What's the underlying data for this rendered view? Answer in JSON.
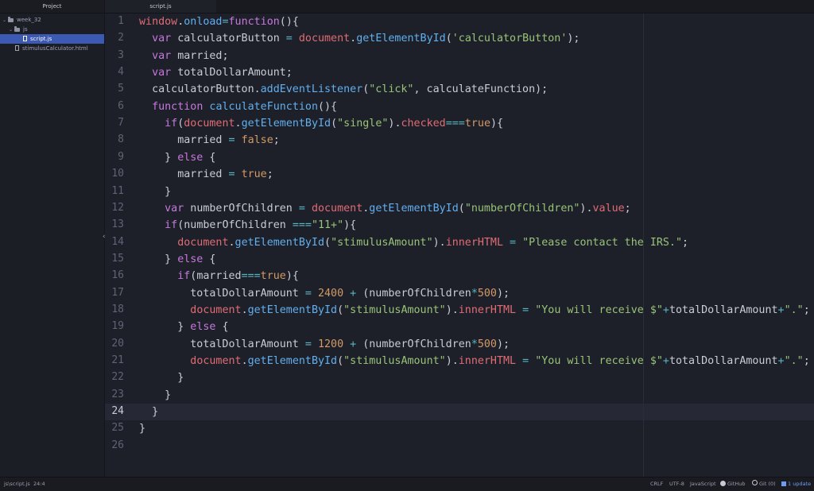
{
  "sidebar": {
    "header": "Project",
    "tree": [
      {
        "label": "week_32",
        "type": "folder",
        "expanded": true,
        "selected": false
      },
      {
        "label": "js",
        "type": "folder",
        "expanded": true,
        "selected": false
      },
      {
        "label": "script.js",
        "type": "file",
        "selected": true
      },
      {
        "label": "stimulusCalculator.html",
        "type": "file",
        "selected": false
      }
    ],
    "toggle_icon": "‹"
  },
  "tabs": [
    {
      "label": "script.js",
      "active": true
    }
  ],
  "editor": {
    "language": "JavaScript",
    "current_line": 24,
    "lines": [
      [
        [
          "vr",
          "window"
        ],
        [
          "pl",
          "."
        ],
        [
          "fn",
          "onload"
        ],
        [
          "op",
          "="
        ],
        [
          "kw",
          "function"
        ],
        [
          "pl",
          "(){"
        ]
      ],
      [
        [
          "pl",
          "  "
        ],
        [
          "kw",
          "var"
        ],
        [
          "pl",
          " calculatorButton "
        ],
        [
          "op",
          "="
        ],
        [
          "pl",
          " "
        ],
        [
          "vr",
          "document"
        ],
        [
          "pl",
          "."
        ],
        [
          "fn",
          "getElementById"
        ],
        [
          "pl",
          "("
        ],
        [
          "st",
          "'calculatorButton'"
        ],
        [
          "pl",
          ");"
        ]
      ],
      [
        [
          "pl",
          "  "
        ],
        [
          "kw",
          "var"
        ],
        [
          "pl",
          " married;"
        ]
      ],
      [
        [
          "pl",
          "  "
        ],
        [
          "kw",
          "var"
        ],
        [
          "pl",
          " totalDollarAmount;"
        ]
      ],
      [
        [
          "pl",
          "  calculatorButton."
        ],
        [
          "fn",
          "addEventListener"
        ],
        [
          "pl",
          "("
        ],
        [
          "st",
          "\"click\""
        ],
        [
          "pl",
          ", calculateFunction);"
        ]
      ],
      [
        [
          "pl",
          "  "
        ],
        [
          "kw",
          "function"
        ],
        [
          "pl",
          " "
        ],
        [
          "fn",
          "calculateFunction"
        ],
        [
          "pl",
          "(){"
        ]
      ],
      [
        [
          "pl",
          "    "
        ],
        [
          "kw",
          "if"
        ],
        [
          "pl",
          "("
        ],
        [
          "vr",
          "document"
        ],
        [
          "pl",
          "."
        ],
        [
          "fn",
          "getElementById"
        ],
        [
          "pl",
          "("
        ],
        [
          "st",
          "\"single\""
        ],
        [
          "pl",
          ")."
        ],
        [
          "vr",
          "checked"
        ],
        [
          "op",
          "==="
        ],
        [
          "nm",
          "true"
        ],
        [
          "pl",
          "){"
        ]
      ],
      [
        [
          "pl",
          "      married "
        ],
        [
          "op",
          "="
        ],
        [
          "pl",
          " "
        ],
        [
          "nm",
          "false"
        ],
        [
          "pl",
          ";"
        ]
      ],
      [
        [
          "pl",
          "    } "
        ],
        [
          "kw",
          "else"
        ],
        [
          "pl",
          " {"
        ]
      ],
      [
        [
          "pl",
          "      married "
        ],
        [
          "op",
          "="
        ],
        [
          "pl",
          " "
        ],
        [
          "nm",
          "true"
        ],
        [
          "pl",
          ";"
        ]
      ],
      [
        [
          "pl",
          "    }"
        ]
      ],
      [
        [
          "pl",
          "    "
        ],
        [
          "kw",
          "var"
        ],
        [
          "pl",
          " numberOfChildren "
        ],
        [
          "op",
          "="
        ],
        [
          "pl",
          " "
        ],
        [
          "vr",
          "document"
        ],
        [
          "pl",
          "."
        ],
        [
          "fn",
          "getElementById"
        ],
        [
          "pl",
          "("
        ],
        [
          "st",
          "\"numberOfChildren\""
        ],
        [
          "pl",
          ")."
        ],
        [
          "vr",
          "value"
        ],
        [
          "pl",
          ";"
        ]
      ],
      [
        [
          "pl",
          "    "
        ],
        [
          "kw",
          "if"
        ],
        [
          "pl",
          "(numberOfChildren "
        ],
        [
          "op",
          "==="
        ],
        [
          "st",
          "\"11+\""
        ],
        [
          "pl",
          "){"
        ]
      ],
      [
        [
          "pl",
          "      "
        ],
        [
          "vr",
          "document"
        ],
        [
          "pl",
          "."
        ],
        [
          "fn",
          "getElementById"
        ],
        [
          "pl",
          "("
        ],
        [
          "st",
          "\"stimulusAmount\""
        ],
        [
          "pl",
          ")."
        ],
        [
          "vr",
          "innerHTML"
        ],
        [
          "pl",
          " "
        ],
        [
          "op",
          "="
        ],
        [
          "pl",
          " "
        ],
        [
          "st",
          "\"Please contact the IRS.\""
        ],
        [
          "pl",
          ";"
        ]
      ],
      [
        [
          "pl",
          "    } "
        ],
        [
          "kw",
          "else"
        ],
        [
          "pl",
          " {"
        ]
      ],
      [
        [
          "pl",
          "      "
        ],
        [
          "kw",
          "if"
        ],
        [
          "pl",
          "(married"
        ],
        [
          "op",
          "==="
        ],
        [
          "nm",
          "true"
        ],
        [
          "pl",
          "){"
        ]
      ],
      [
        [
          "pl",
          "        totalDollarAmount "
        ],
        [
          "op",
          "="
        ],
        [
          "pl",
          " "
        ],
        [
          "nm",
          "2400"
        ],
        [
          "pl",
          " "
        ],
        [
          "op",
          "+"
        ],
        [
          "pl",
          " (numberOfChildren"
        ],
        [
          "op",
          "*"
        ],
        [
          "nm",
          "500"
        ],
        [
          "pl",
          ");"
        ]
      ],
      [
        [
          "pl",
          "        "
        ],
        [
          "vr",
          "document"
        ],
        [
          "pl",
          "."
        ],
        [
          "fn",
          "getElementById"
        ],
        [
          "pl",
          "("
        ],
        [
          "st",
          "\"stimulusAmount\""
        ],
        [
          "pl",
          ")."
        ],
        [
          "vr",
          "innerHTML"
        ],
        [
          "pl",
          " "
        ],
        [
          "op",
          "="
        ],
        [
          "pl",
          " "
        ],
        [
          "st",
          "\"You will receive $\""
        ],
        [
          "op",
          "+"
        ],
        [
          "pl",
          "totalDollarAmount"
        ],
        [
          "op",
          "+"
        ],
        [
          "st",
          "\".\""
        ],
        [
          "pl",
          ";"
        ]
      ],
      [
        [
          "pl",
          "      } "
        ],
        [
          "kw",
          "else"
        ],
        [
          "pl",
          " {"
        ]
      ],
      [
        [
          "pl",
          "        totalDollarAmount "
        ],
        [
          "op",
          "="
        ],
        [
          "pl",
          " "
        ],
        [
          "nm",
          "1200"
        ],
        [
          "pl",
          " "
        ],
        [
          "op",
          "+"
        ],
        [
          "pl",
          " (numberOfChildren"
        ],
        [
          "op",
          "*"
        ],
        [
          "nm",
          "500"
        ],
        [
          "pl",
          ");"
        ]
      ],
      [
        [
          "pl",
          "        "
        ],
        [
          "vr",
          "document"
        ],
        [
          "pl",
          "."
        ],
        [
          "fn",
          "getElementById"
        ],
        [
          "pl",
          "("
        ],
        [
          "st",
          "\"stimulusAmount\""
        ],
        [
          "pl",
          ")."
        ],
        [
          "vr",
          "innerHTML"
        ],
        [
          "pl",
          " "
        ],
        [
          "op",
          "="
        ],
        [
          "pl",
          " "
        ],
        [
          "st",
          "\"You will receive $\""
        ],
        [
          "op",
          "+"
        ],
        [
          "pl",
          "totalDollarAmount"
        ],
        [
          "op",
          "+"
        ],
        [
          "st",
          "\".\""
        ],
        [
          "pl",
          ";"
        ]
      ],
      [
        [
          "pl",
          "      }"
        ]
      ],
      [
        [
          "pl",
          "    }"
        ]
      ],
      [
        [
          "pl",
          "  }"
        ]
      ],
      [
        [
          "pl",
          "}"
        ]
      ],
      [
        [
          "pl",
          ""
        ]
      ]
    ]
  },
  "statusbar": {
    "file_path": "js\\script.js",
    "cursor_position": "24:4",
    "line_ending": "CRLF",
    "encoding": "UTF-8",
    "grammar": "JavaScript",
    "github_label": "GitHub",
    "git_label": "Git (0)",
    "update_label": "1 update"
  },
  "colors": {
    "keyword": "#c678dd",
    "function": "#61afef",
    "variable": "#e06c75",
    "string": "#98c379",
    "number": "#d19a66",
    "operator": "#56b6c2",
    "selection": "#3c59b3"
  }
}
